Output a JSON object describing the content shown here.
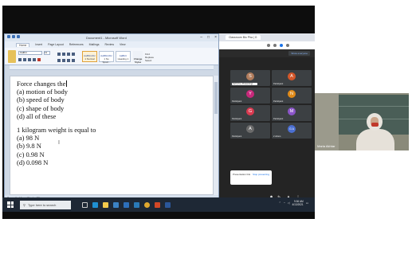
{
  "word": {
    "title": "Document1 - Microsoft Word",
    "ribbon_tabs": [
      "Home",
      "Insert",
      "Page Layout",
      "References",
      "Mailings",
      "Review",
      "View"
    ],
    "font_name": "Calibri",
    "font_size": "11",
    "styles": [
      {
        "preview": "AaBbCcDc",
        "name": "1 Normal"
      },
      {
        "preview": "AaBbCcDc",
        "name": "1 No Spaci..."
      },
      {
        "preview": "AaBbC",
        "name": "Heading 1"
      }
    ],
    "change_styles": "Change Styles",
    "editing": [
      "Find",
      "Replace",
      "Select"
    ],
    "status": [
      "Page: 1 of 1",
      "Words: 39"
    ],
    "doc_lines": [
      "Force changes the",
      "(a) motion of body",
      "(b) speed of body",
      "(c) shape of body",
      "(d) all of these",
      "1 kilogram weight is equal to",
      "(a) 98 N",
      "(b) 9.8 N",
      "(c) 0.98 N",
      "(d) 0.098 N"
    ]
  },
  "chrome": {
    "tab_title": "Classroom Bio Pha | G",
    "meet_action": "Show everyone"
  },
  "participants": [
    {
      "initial": "S",
      "name": "Self (You, Presenting)",
      "color": "#b07c5c",
      "self": true
    },
    {
      "initial": "A",
      "name": "Participant",
      "color": "#d4572a"
    },
    {
      "initial": "Y",
      "name": "Participant",
      "color": "#c7287a"
    },
    {
      "initial": "N",
      "name": "Participant",
      "color": "#e08a18"
    },
    {
      "initial": "G",
      "name": "Participant",
      "color": "#d93a50"
    },
    {
      "initial": "M",
      "name": "Participant",
      "color": "#8c55c9"
    },
    {
      "initial": "A",
      "name": "Participant",
      "color": "#6b6b6b"
    },
    {
      "initial": "G A",
      "name": "2 others",
      "color": "#4b6fd1"
    }
  ],
  "present_card": {
    "text": "Presentation link",
    "action": "Stop presenting"
  },
  "taskbar": {
    "search_placeholder": "Type here to search",
    "time": "9:36 AM",
    "date": "4/13/2021"
  },
  "camera": {
    "name": "Maria Akhtar"
  }
}
